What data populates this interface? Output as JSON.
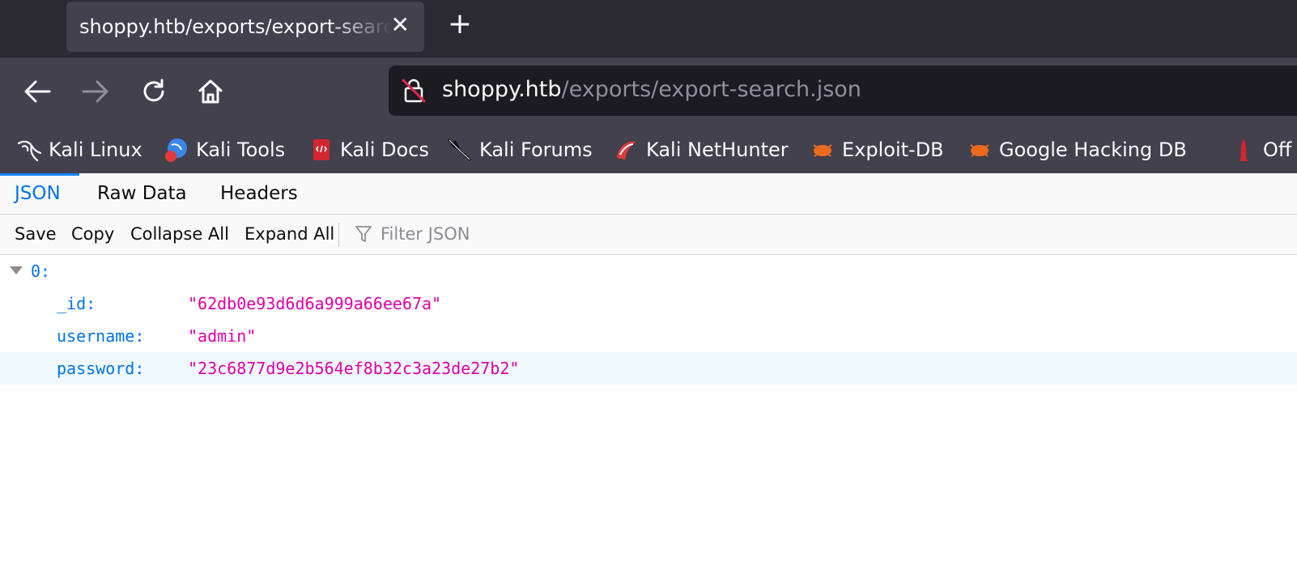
{
  "tab": {
    "title": "shoppy.htb/exports/export-search.json",
    "close": "✕",
    "new_tab": "+"
  },
  "url": {
    "host": "shoppy.htb",
    "path": "/exports/export-search.json"
  },
  "bookmarks": [
    {
      "label": "Kali Linux",
      "icon": "kali-dragon-icon"
    },
    {
      "label": "Kali Tools",
      "icon": "kali-tools-icon"
    },
    {
      "label": "Kali Docs",
      "icon": "kali-docs-icon"
    },
    {
      "label": "Kali Forums",
      "icon": "kali-forums-icon"
    },
    {
      "label": "Kali NetHunter",
      "icon": "kali-nethunter-icon"
    },
    {
      "label": "Exploit-DB",
      "icon": "exploit-db-icon"
    },
    {
      "label": "Google Hacking DB",
      "icon": "ghdb-icon"
    },
    {
      "label": "Off",
      "icon": "offsec-icon"
    }
  ],
  "viewer_tabs": [
    "JSON",
    "Raw Data",
    "Headers"
  ],
  "toolbar": {
    "save": "Save",
    "copy": "Copy",
    "collapse_all": "Collapse All",
    "expand_all": "Expand All",
    "filter_placeholder": "Filter JSON"
  },
  "json": {
    "index_key": "0:",
    "rows": [
      {
        "key": "_id:",
        "value": "\"62db0e93d6d6a999a66ee67a\""
      },
      {
        "key": "username:",
        "value": "\"admin\""
      },
      {
        "key": "password:",
        "value": "\"23c6877d9e2b564ef8b32c3a23de27b2\""
      }
    ]
  },
  "colors": {
    "json_key": "#0074e8",
    "json_string": "#dd00a9",
    "selected_tab": "#0a84ff",
    "highlight_row": "#f0f9fe"
  }
}
